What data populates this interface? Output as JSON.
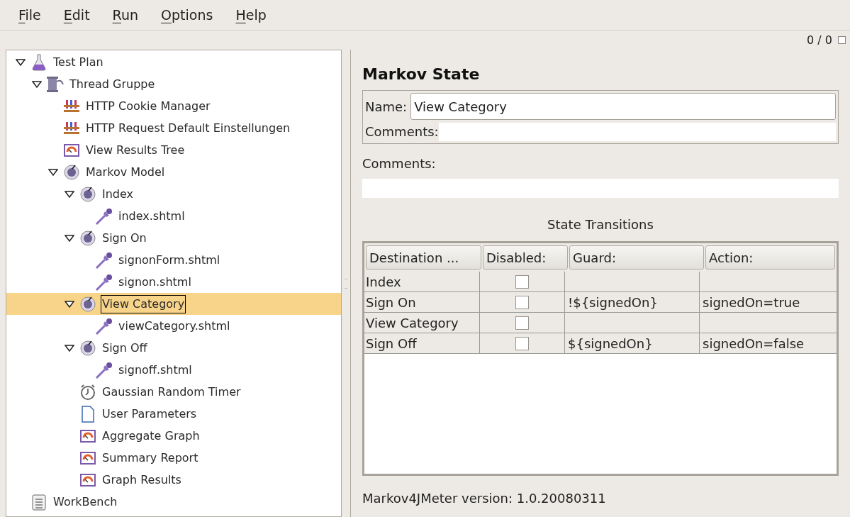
{
  "menu": [
    {
      "label": "File"
    },
    {
      "label": "Edit"
    },
    {
      "label": "Run"
    },
    {
      "label": "Options"
    },
    {
      "label": "Help"
    }
  ],
  "toolbar": {
    "counter": "0 / 0"
  },
  "tree": [
    {
      "label": "Test Plan",
      "kind": "flask",
      "expanded": true,
      "selected": false,
      "children": [
        {
          "label": "Thread Gruppe",
          "kind": "thread",
          "expanded": true,
          "selected": false,
          "children": [
            {
              "label": "HTTP Cookie Manager",
              "kind": "config",
              "selected": false
            },
            {
              "label": "HTTP Request Default Einstellungen",
              "kind": "config",
              "selected": false
            },
            {
              "label": "View Results Tree",
              "kind": "listener",
              "selected": false
            },
            {
              "label": "Markov Model",
              "kind": "markov",
              "expanded": true,
              "selected": false,
              "children": [
                {
                  "label": "Index",
                  "kind": "markov",
                  "expanded": true,
                  "selected": false,
                  "children": [
                    {
                      "label": "index.shtml",
                      "kind": "sampler",
                      "selected": false
                    }
                  ]
                },
                {
                  "label": "Sign On",
                  "kind": "markov",
                  "expanded": true,
                  "selected": false,
                  "children": [
                    {
                      "label": "signonForm.shtml",
                      "kind": "sampler",
                      "selected": false
                    },
                    {
                      "label": "signon.shtml",
                      "kind": "sampler",
                      "selected": false
                    }
                  ]
                },
                {
                  "label": "View Category",
                  "kind": "markov",
                  "expanded": true,
                  "selected": true,
                  "children": [
                    {
                      "label": "viewCategory.shtml",
                      "kind": "sampler",
                      "selected": false
                    }
                  ]
                },
                {
                  "label": "Sign Off",
                  "kind": "markov",
                  "expanded": true,
                  "selected": false,
                  "children": [
                    {
                      "label": "signoff.shtml",
                      "kind": "sampler",
                      "selected": false
                    }
                  ]
                },
                {
                  "label": "Gaussian Random Timer",
                  "kind": "timer",
                  "selected": false
                },
                {
                  "label": "User Parameters",
                  "kind": "document",
                  "selected": false
                },
                {
                  "label": "Aggregate Graph",
                  "kind": "listener",
                  "selected": false
                },
                {
                  "label": "Summary Report",
                  "kind": "listener",
                  "selected": false
                },
                {
                  "label": "Graph Results",
                  "kind": "listener",
                  "selected": false
                }
              ]
            }
          ]
        }
      ]
    },
    {
      "label": "WorkBench",
      "kind": "workbench",
      "selected": false
    }
  ],
  "details": {
    "title": "Markov State",
    "name_field": {
      "label": "Name:",
      "value": "View Category"
    },
    "inner_comments": {
      "label": "Comments:"
    },
    "comments": {
      "label": "Comments:"
    },
    "transitions": {
      "title": "State Transitions",
      "columns": [
        "Destination ...",
        "Disabled:",
        "Guard:",
        "Action:"
      ],
      "rows": [
        {
          "destination": "Index",
          "disabled": false
        },
        {
          "destination": "Sign On",
          "disabled": false,
          "guard": "!${signedOn}",
          "action": "signedOn=true"
        },
        {
          "destination": "View Category",
          "disabled": false
        },
        {
          "destination": "Sign Off",
          "disabled": false,
          "guard": "${signedOn}",
          "action": "signedOn=false"
        }
      ]
    },
    "version": "Markov4JMeter version: 1.0.20080311"
  }
}
